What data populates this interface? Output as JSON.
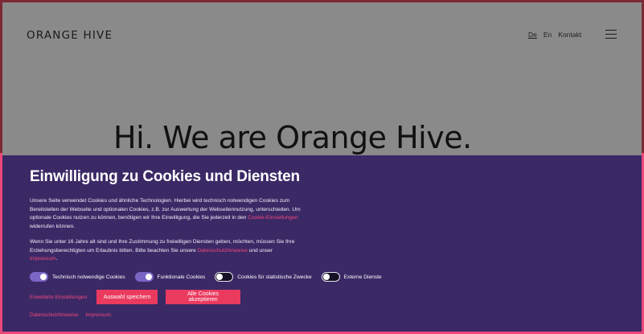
{
  "header": {
    "logo": "ORANGE HIVE",
    "nav": {
      "de": "De",
      "en": "En",
      "contact": "Kontakt"
    }
  },
  "hero": {
    "title": "Hi. We are Orange Hive."
  },
  "consent": {
    "title": "Einwilligung zu Cookies und Diensten",
    "p1_text": "Unsere Seite verwendet Cookies und ähnliche Technologien. Hierbei wird technisch notwendigen Cookies zum Bereitstellen der Webseite und optionalen Cookies, z.B. zur Auswertung der Webseitennutzung, unterschieden. Um optionale Cookies nutzen zu können, benötigen wir Ihre Einwilligung, die Sie jederzeit in den ",
    "p1_link": "Cookie-Einstellungen",
    "p1_end": " widerrufen können.",
    "p2_text": "Wenn Sie unter 16 Jahre alt sind und Ihre Zustimmung zu freiwilligen Diensten geben, möchten, müssen Sie Ihre Erziehungsberechtigten um Erlaubnis bitten. Bitte beachten Sie unsere ",
    "p2_link1": "Datenschutzhinweise",
    "p2_mid": " und unser ",
    "p2_link2": "Impressum",
    "p2_end": ".",
    "toggles": [
      {
        "label": "Technisch notwendige Cookies",
        "on": true
      },
      {
        "label": "Funktionale Cookies",
        "on": true
      },
      {
        "label": "Cookies für statistische Zwecke",
        "on": false
      },
      {
        "label": "Externe Dienste",
        "on": false
      }
    ],
    "extended_settings": "Erweiterte Einstellungen",
    "save_selection": "Auswahl speichern",
    "accept_all": "Alle Cookies akzeptieren",
    "footer_privacy": "Datenschutzhinweise",
    "footer_imprint": "Impressum"
  }
}
